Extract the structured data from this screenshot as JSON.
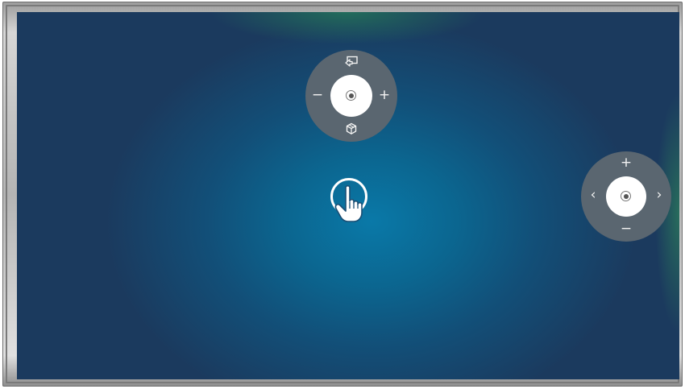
{
  "screen": {
    "background": "#0a79a8"
  },
  "zoom_control": {
    "minus_label": "−",
    "plus_label": "+",
    "top_icon": "screen-pointer-icon",
    "bottom_icon": "cube-3d-icon",
    "center_icon": "select-dot-icon"
  },
  "nav_control": {
    "up_label": "+",
    "down_label": "−",
    "left_label": "‹",
    "right_label": "›",
    "center_icon": "select-dot-icon"
  },
  "pointer": {
    "icon": "hand-pointer-icon"
  }
}
